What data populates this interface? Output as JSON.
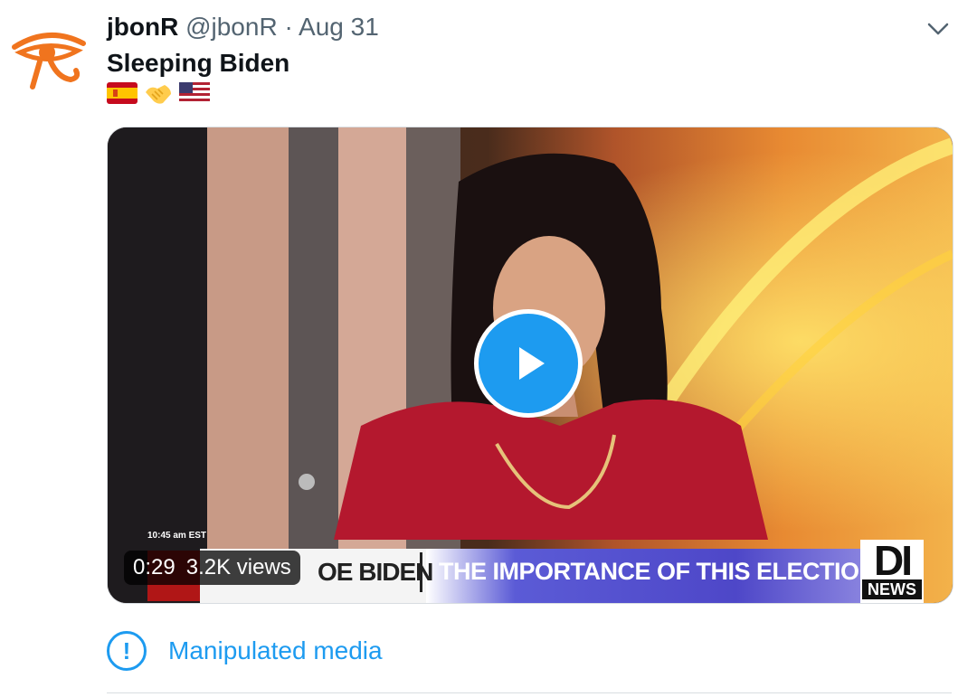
{
  "tweet": {
    "author_name": "jbonR",
    "handle": "@jbonR",
    "separator": "·",
    "date": "Aug 31",
    "text": "Sleeping Biden",
    "emojis": [
      "spain-flag-icon",
      "handshake-icon",
      "us-flag-icon"
    ]
  },
  "video": {
    "duration": "0:29",
    "views": "3.2K views",
    "on_screen_time": "10:45 am EST",
    "ticker_name": "OE BIDEN",
    "ticker_headline": "THE IMPORTANCE OF THIS ELECTION",
    "channel_logo": "DI",
    "channel_logo_sub": "NEWS"
  },
  "notice": {
    "label": "Manipulated media",
    "icon": "exclamation-circle-icon"
  },
  "colors": {
    "accent": "#1d9bf0",
    "text": "#0f1419",
    "secondary_text": "#536471",
    "avatar_orange": "#f0741e"
  }
}
